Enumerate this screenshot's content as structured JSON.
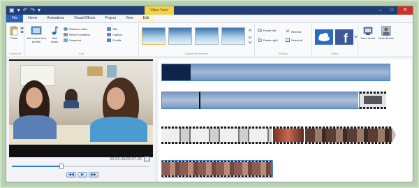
{
  "titlebar": {
    "quick_access": [
      "▣",
      "▾",
      "↶",
      "↷",
      "▾"
    ],
    "context_tab_label": "Video Tools",
    "window_buttons": {
      "minimize": "–",
      "maximize": "□",
      "close": "✕"
    }
  },
  "tabs": [
    {
      "label": "File"
    },
    {
      "label": "Home"
    },
    {
      "label": "Animations"
    },
    {
      "label": "Visual Effects"
    },
    {
      "label": "Project"
    },
    {
      "label": "View"
    },
    {
      "label": "Edit"
    }
  ],
  "ribbon": {
    "clipboard": {
      "label": "Clipboard",
      "paste": "Paste"
    },
    "add": {
      "label": "Add",
      "add_videos": "Add videos and photos",
      "add_music": "Add music",
      "webcam": "Webcam video",
      "narration": "Record narration",
      "snapshot": "Snapshot",
      "title": "Title",
      "caption": "Caption",
      "credits": "Credits"
    },
    "autoMovie": {
      "label": "AutoMovie themes"
    },
    "editing": {
      "label": "Editing",
      "rotate_left": "Rotate left",
      "rotate_right": "Rotate right",
      "remove": "Remove",
      "select_all": "Select all"
    },
    "share": {
      "label": "Share"
    },
    "save_movie": "Save movie",
    "sign_in": "Kevin Brown"
  },
  "preview": {
    "timecode": "00:00.00/00:07.05",
    "controls": {
      "prev": "◀◀",
      "play": "▶",
      "next": "▶▶"
    },
    "progress": 0.36
  },
  "colors": {
    "accent": "#2a63b8",
    "file_tab": "#2a63b8",
    "context_tab": "#f1d24a",
    "close_button": "#c8322c",
    "selection": "#3b8ad8"
  }
}
